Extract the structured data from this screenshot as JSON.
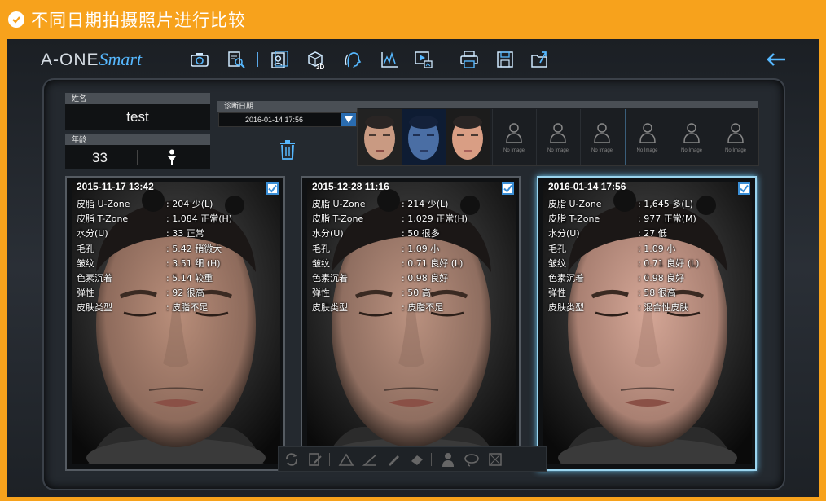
{
  "banner": {
    "title": "不同日期拍摄照片进行比较"
  },
  "app": {
    "logo_main": "A-ONE",
    "logo_accent": "Smart",
    "toolbar_icons": [
      "camera-icon",
      "search-document-icon",
      "compare-icon",
      "3d-icon",
      "face-profile-icon",
      "chart-icon",
      "slideshow-icon",
      "print-icon",
      "save-icon",
      "export-icon"
    ],
    "badge_3d": "3D",
    "back_icon": "back-arrow-icon"
  },
  "patient": {
    "name_label": "姓名",
    "name": "test",
    "age_label": "年龄",
    "age": "33",
    "gender_icon": "male-icon"
  },
  "diagnosis": {
    "date_label": "诊断日期",
    "selected_date": "2016-01-14 17:56",
    "no_image_text": "No Image",
    "empty_slots": 6
  },
  "panels": [
    {
      "date": "2015-11-17 13:42",
      "checked": true,
      "metrics": [
        {
          "name": "皮脂 U-Zone",
          "value": ": 204 少(L)"
        },
        {
          "name": "皮脂 T-Zone",
          "value": ": 1,084 正常(H)"
        },
        {
          "name": "水分(U)",
          "value": ": 33 正常"
        },
        {
          "name": "毛孔",
          "value": ": 5.42 稍微大"
        },
        {
          "name": "皱纹",
          "value": ": 3.51 细 (H)"
        },
        {
          "name": "色素沉着",
          "value": ": 5.14 较重"
        },
        {
          "name": "弹性",
          "value": ": 92 很高"
        },
        {
          "name": "皮肤类型",
          "value": ": 皮脂不足"
        }
      ]
    },
    {
      "date": "2015-12-28 11:16",
      "checked": true,
      "metrics": [
        {
          "name": "皮脂 U-Zone",
          "value": ": 214 少(L)"
        },
        {
          "name": "皮脂 T-Zone",
          "value": ": 1,029 正常(H)"
        },
        {
          "name": "水分(U)",
          "value": ": 50 很多"
        },
        {
          "name": "毛孔",
          "value": ": 1.09 小"
        },
        {
          "name": "皱纹",
          "value": ": 0.71 良好 (L)"
        },
        {
          "name": "色素沉着",
          "value": ": 0.98 良好"
        },
        {
          "name": "弹性",
          "value": ": 50 高"
        },
        {
          "name": "皮肤类型",
          "value": ": 皮脂不足"
        }
      ]
    },
    {
      "date": "2016-01-14 17:56",
      "checked": true,
      "metrics": [
        {
          "name": "皮脂 U-Zone",
          "value": ": 1,645 多(L)"
        },
        {
          "name": "皮脂 T-Zone",
          "value": ": 977 正常(M)"
        },
        {
          "name": "水分(U)",
          "value": ": 27 低"
        },
        {
          "name": "毛孔",
          "value": ": 1.09 小"
        },
        {
          "name": "皱纹",
          "value": ": 0.71 良好 (L)"
        },
        {
          "name": "色素沉着",
          "value": ": 0.98 良好"
        },
        {
          "name": "弹性",
          "value": ": 58 很高"
        },
        {
          "name": "皮肤类型",
          "value": ": 混合性皮肤"
        }
      ]
    }
  ],
  "bottom_tools": [
    "refresh-icon",
    "edit-icon",
    "triangle-icon",
    "angle-icon",
    "pen-icon",
    "eraser-icon",
    "person-icon",
    "lasso-icon",
    "crop-icon"
  ],
  "colors": {
    "banner": "#f7a21c",
    "accent": "#56b8ff",
    "selected_border": "#9ad4ee"
  }
}
